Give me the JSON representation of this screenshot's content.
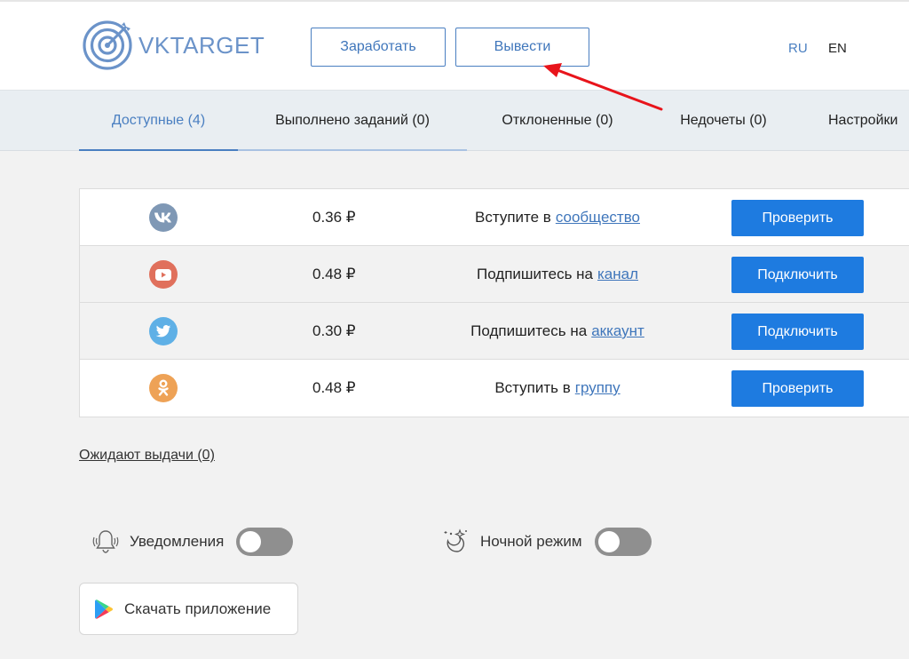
{
  "header": {
    "logo_text": "VKTARGET",
    "earn_button": "Заработать",
    "withdraw_button": "Вывести",
    "lang_ru": "RU",
    "lang_en": "EN"
  },
  "tabs": [
    {
      "label": "Доступные (4)",
      "active": true
    },
    {
      "label": "Выполнено заданий (0)",
      "active": false
    },
    {
      "label": "Отклоненные (0)",
      "active": false
    },
    {
      "label": "Недочеты (0)",
      "active": false
    },
    {
      "label": "Настройки",
      "active": false
    }
  ],
  "tasks": [
    {
      "network": "vk",
      "icon": "vk-icon",
      "price": "0.36 ₽",
      "task_text": "Вступите в",
      "link": "сообщество",
      "button": "Проверить"
    },
    {
      "network": "youtube",
      "icon": "youtube-icon",
      "price": "0.48 ₽",
      "task_text": "Подпишитесь на",
      "link": "канал",
      "button": "Подключить"
    },
    {
      "network": "twitter",
      "icon": "twitter-icon",
      "price": "0.30 ₽",
      "task_text": "Подпишитесь на",
      "link": "аккаунт",
      "button": "Подключить"
    },
    {
      "network": "odnoklassniki",
      "icon": "odnoklassniki-icon",
      "price": "0.48 ₽",
      "task_text": "Вступить в",
      "link": "группу",
      "button": "Проверить"
    }
  ],
  "pending_link": "Ожидают выдачи (0)",
  "settings": {
    "notifications_label": "Уведомления",
    "notifications_on": false,
    "night_mode_label": "Ночной режим",
    "night_mode_on": false
  },
  "app_button": "Скачать приложение",
  "colors": {
    "accent": "#4a7fc1",
    "primary_button": "#1e7be0",
    "vk": "#7f98b5",
    "youtube": "#e0705c",
    "twitter": "#5fb0e6",
    "odnoklassniki": "#eea256",
    "annotation_arrow": "#e8141b"
  }
}
